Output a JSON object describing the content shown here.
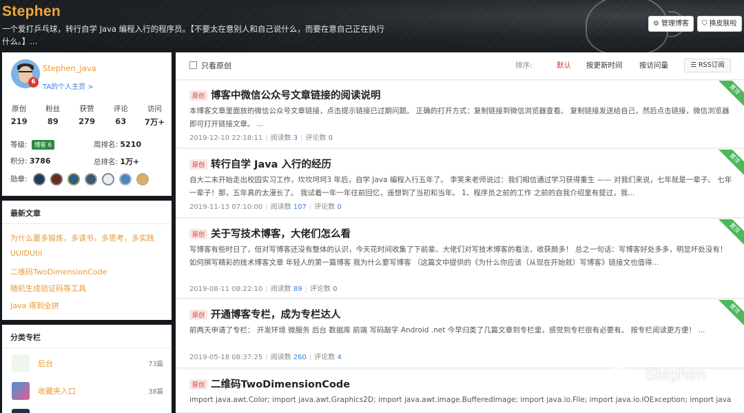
{
  "header": {
    "blog_name": "Stephen",
    "description": "一个爱打乒乓球，转行自学 Java 编程入行的程序员。【不要太在意别人和自己说什么，而要在意自己正在执行什么。】...",
    "manage_btn": "管理博客",
    "skin_btn": "换皮肤啦"
  },
  "profile": {
    "username": "Stephen_java",
    "badge_level": "6",
    "homepage_link": "TA的个人主页 >",
    "stats": [
      {
        "label": "原创",
        "value": "219"
      },
      {
        "label": "粉丝",
        "value": "89"
      },
      {
        "label": "获赞",
        "value": "279"
      },
      {
        "label": "评论",
        "value": "63"
      },
      {
        "label": "访问",
        "value": "7万+"
      }
    ],
    "level_label": "等级:",
    "level_badge": "博客 6",
    "week_rank_label": "周排名:",
    "week_rank": "5210",
    "points_label": "积分:",
    "points": "3786",
    "total_rank_label": "总排名:",
    "total_rank": "1万+",
    "medals_label": "勋章:"
  },
  "latest": {
    "title": "最新文章",
    "items": [
      "为什么要多锻炼，多读书，多思考，多实践",
      "UUIDUtil",
      "二维码TwoDimensionCode",
      "随机生成验证码等工具",
      "Java 得到全拼"
    ]
  },
  "columns": {
    "title": "分类专栏",
    "items": [
      {
        "name": "后台",
        "count": "73篇"
      },
      {
        "name": "收藏夹入口",
        "count": "38篇"
      }
    ]
  },
  "toolbar": {
    "only_original": "只看原创",
    "sort_label": "排序:",
    "sort_default": "默认",
    "sort_update": "按更新时间",
    "sort_visit": "按访问量",
    "rss": "RSS订阅"
  },
  "articles": [
    {
      "tag": "原创",
      "title": "博客中微信公众号文章链接的阅读说明",
      "body": "本博客文章里面放的微信公众号文章链接，点击提示链接已过期问题。 正确的打开方式：复制链接到微信浏览器查看。 复制链接发送给自己，然后点击链接，微信浏览器即可打开链接文章。 ...",
      "date": "2019-12-10 22:18:11",
      "reads_label": "阅读数",
      "reads": "3",
      "comments_label": "评论数",
      "comments": "0",
      "pinned": "置顶"
    },
    {
      "tag": "原创",
      "title": "转行自学 Java 入行的经历",
      "body": "自大二末开始走出校园实习工作，坎坎坷坷3 年后，自学 Java 编程入行五年了。 李笑来老师说过：我们相信通过学习获得重生 —— 对我们来说，七年就是一辈子。 七年一辈子！那，五年真的太漫长了。 我试着一年一年往前回忆，遥想到了当初和当年。 1、程序员之前的工作 之前的自我介绍里有提过，我...",
      "date": "2019-11-13 07:10:00",
      "reads_label": "阅读数",
      "reads": "107",
      "comments_label": "评论数",
      "comments": "0",
      "pinned": "置顶"
    },
    {
      "tag": "原创",
      "title": "关于写技术博客，大佬们怎么看",
      "body": "写博客有些时日了，但对写博客还没有整体的认识，今天花时间收集了下前辈、大佬们对写技术博客的看法，收获颇多！ 总之一句话：写博客好处多多，明显坏处没有！ 如何撰写精彩的技术博客文章 年轻人的第一篇博客 我为什么要写博客 （这篇文中提供的《为什么你应该（从现在开始就）写博客》链接文也值得...",
      "date": "2019-08-11 08:22:10",
      "reads_label": "阅读数",
      "reads": "89",
      "comments_label": "评论数",
      "comments": "0",
      "pinned": "置顶"
    },
    {
      "tag": "原创",
      "title": "开通博客专栏，成为专栏达人",
      "body": "前两天申请了专栏： 开发环境 微服务 后台 数据库 前端 写码敲字 Android .net 今早归类了几篇文章到专栏里，感觉到专栏很有必要有。 按专栏阅读更方便！ ...",
      "date": "2019-05-18 08:37:25",
      "reads_label": "阅读数",
      "reads": "260",
      "comments_label": "评论数",
      "comments": "4",
      "pinned": "置顶"
    },
    {
      "tag": "原创",
      "title": "二维码TwoDimensionCode",
      "body": "import java.awt.Color; import java.awt.Graphics2D; import java.awt.image.BufferedImage; import java.io.File; import java.io.IOException; import java"
    }
  ],
  "watermark": "Stephen",
  "colors": {
    "accent": "#e89a34",
    "original_tag": "#d93b2e",
    "pinned": "#4cb85a",
    "link": "#3a7dd8"
  }
}
